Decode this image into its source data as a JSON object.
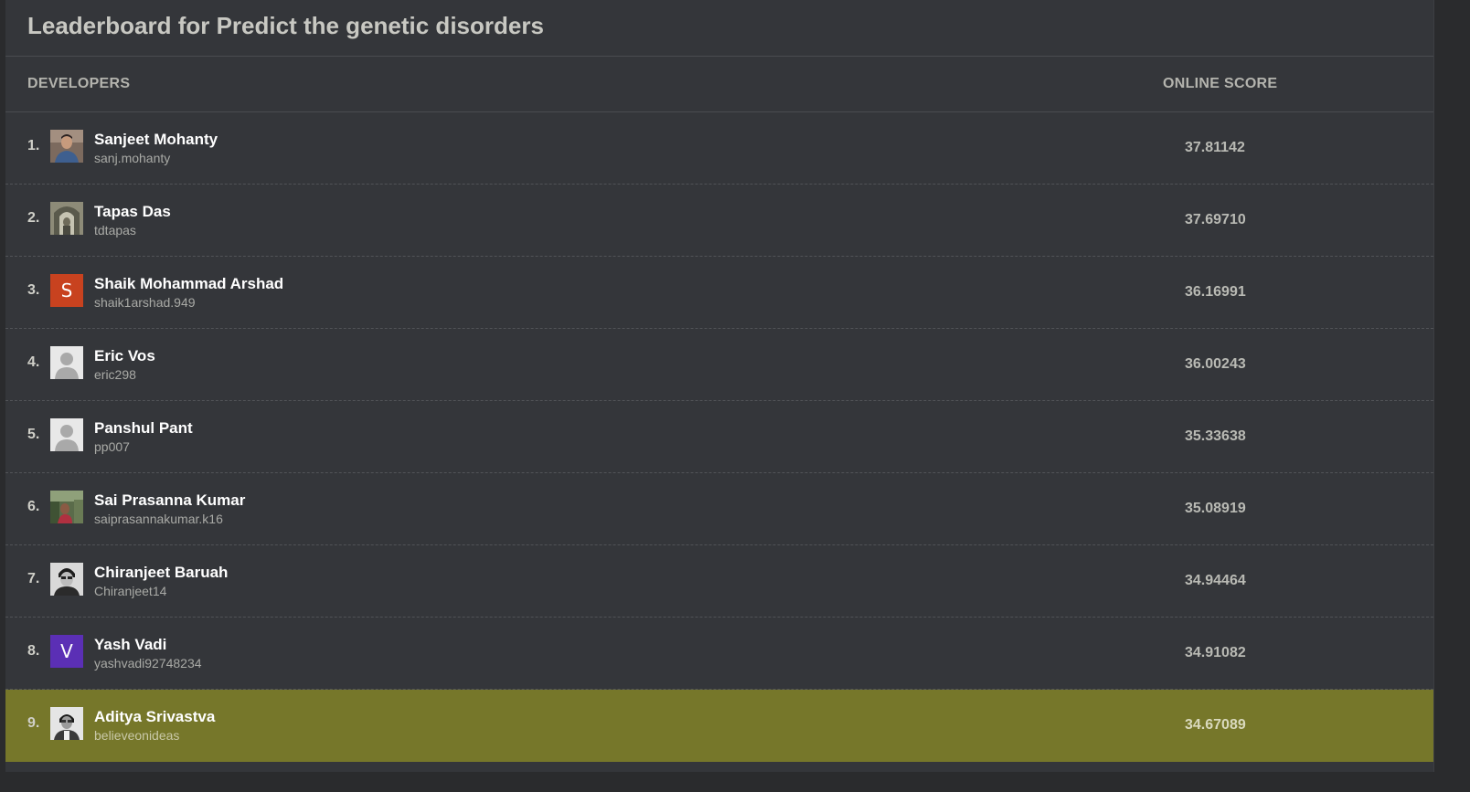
{
  "title": "Leaderboard for Predict the genetic disorders",
  "columns": {
    "developers": "DEVELOPERS",
    "score": "ONLINE SCORE"
  },
  "colors": {
    "highlight": "#76772a",
    "avatar_s": "#c8421f",
    "avatar_v": "#5b2fb5"
  },
  "rows": [
    {
      "rank": "1.",
      "name": "Sanjeet Mohanty",
      "username": "sanj.mohanty",
      "score": "37.81142",
      "avatar": "photo-avatar-1"
    },
    {
      "rank": "2.",
      "name": "Tapas Das",
      "username": "tdtapas",
      "score": "37.69710",
      "avatar": "photo-avatar-2"
    },
    {
      "rank": "3.",
      "name": "Shaik Mohammad Arshad",
      "username": "shaik1arshad.949",
      "score": "36.16991",
      "avatar": "S"
    },
    {
      "rank": "4.",
      "name": "Eric Vos",
      "username": "eric298",
      "score": "36.00243",
      "avatar": "default-user-icon"
    },
    {
      "rank": "5.",
      "name": "Panshul Pant",
      "username": "pp007",
      "score": "35.33638",
      "avatar": "default-user-icon"
    },
    {
      "rank": "6.",
      "name": "Sai Prasanna Kumar",
      "username": "saiprasannakumar.k16",
      "score": "35.08919",
      "avatar": "photo-avatar-6"
    },
    {
      "rank": "7.",
      "name": "Chiranjeet Baruah",
      "username": "Chiranjeet14",
      "score": "34.94464",
      "avatar": "photo-avatar-7"
    },
    {
      "rank": "8.",
      "name": "Yash Vadi",
      "username": "yashvadi92748234",
      "score": "34.91082",
      "avatar": "V"
    },
    {
      "rank": "9.",
      "name": "Aditya Srivastva",
      "username": "believeonideas",
      "score": "34.67089",
      "avatar": "photo-avatar-9"
    }
  ]
}
